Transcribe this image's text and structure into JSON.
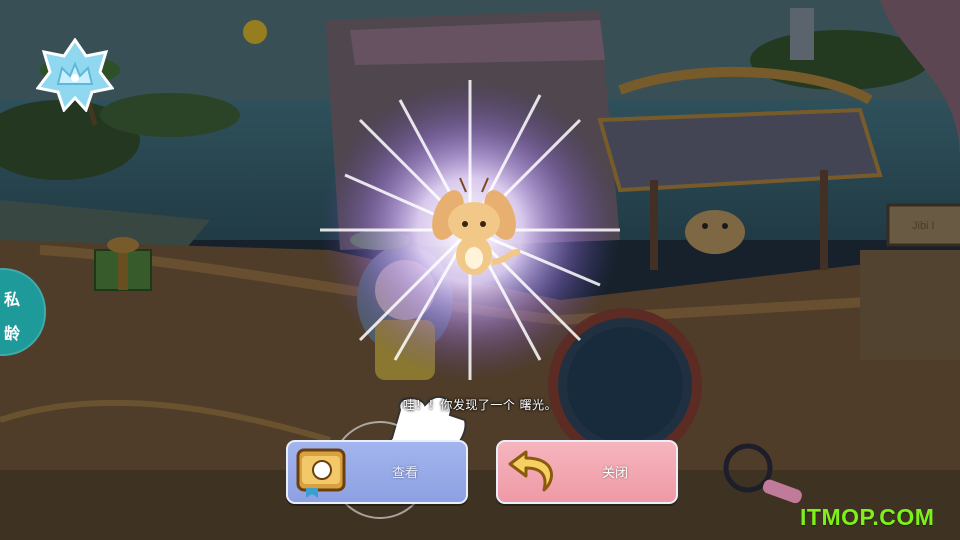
{
  "side_tab": {
    "line1": "私",
    "line2": "龄"
  },
  "discovery": {
    "message": "哇！！你发现了一个 曙光。"
  },
  "buttons": {
    "view_label": "查看",
    "close_label": "关闭"
  },
  "ship_sign": {
    "text": "Jibi I"
  },
  "watermark": {
    "text": "ITMOP.COM"
  },
  "colors": {
    "view_button": "#8da0e2",
    "close_button": "#ee9aa6",
    "side_tab": "#1f9a9a",
    "watermark": "#7ef01a"
  }
}
